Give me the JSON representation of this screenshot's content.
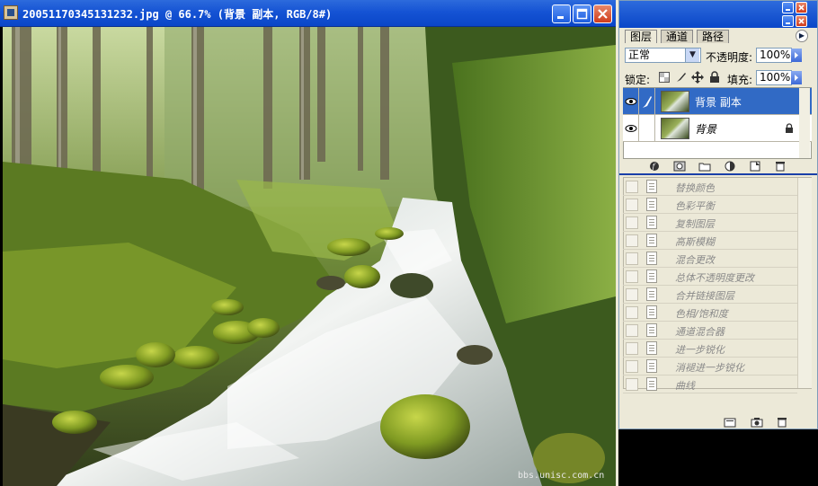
{
  "document": {
    "title": "20051170345131232.jpg @ 66.7% (背景 副本, RGB/8#)",
    "watermark": "bbs.unisc.com.cn"
  },
  "palette": {
    "tabs": [
      {
        "label": "图层",
        "active": true
      },
      {
        "label": "通道",
        "active": false
      },
      {
        "label": "路径",
        "active": false
      }
    ],
    "blend_mode": "正常",
    "opacity_label": "不透明度:",
    "opacity_value": "100%",
    "lock_label": "锁定:",
    "fill_label": "填充:",
    "fill_value": "100%",
    "layers": [
      {
        "name": "背景 副本",
        "selected": true,
        "visible": true
      },
      {
        "name": "背景",
        "selected": false,
        "visible": true,
        "locked": true
      }
    ],
    "history_items": [
      "替换颜色",
      "色彩平衡",
      "复制图层",
      "高斯模糊",
      "混合更改",
      "总体不透明度更改",
      "合并链接图层",
      "色相/饱和度",
      "通道混合器",
      "进一步锐化",
      "消褪进一步锐化",
      "曲线"
    ]
  },
  "colors": {
    "titlebar": "#0a46c8",
    "selected_layer": "#316ac5",
    "palette_bg": "#ece9d8"
  }
}
